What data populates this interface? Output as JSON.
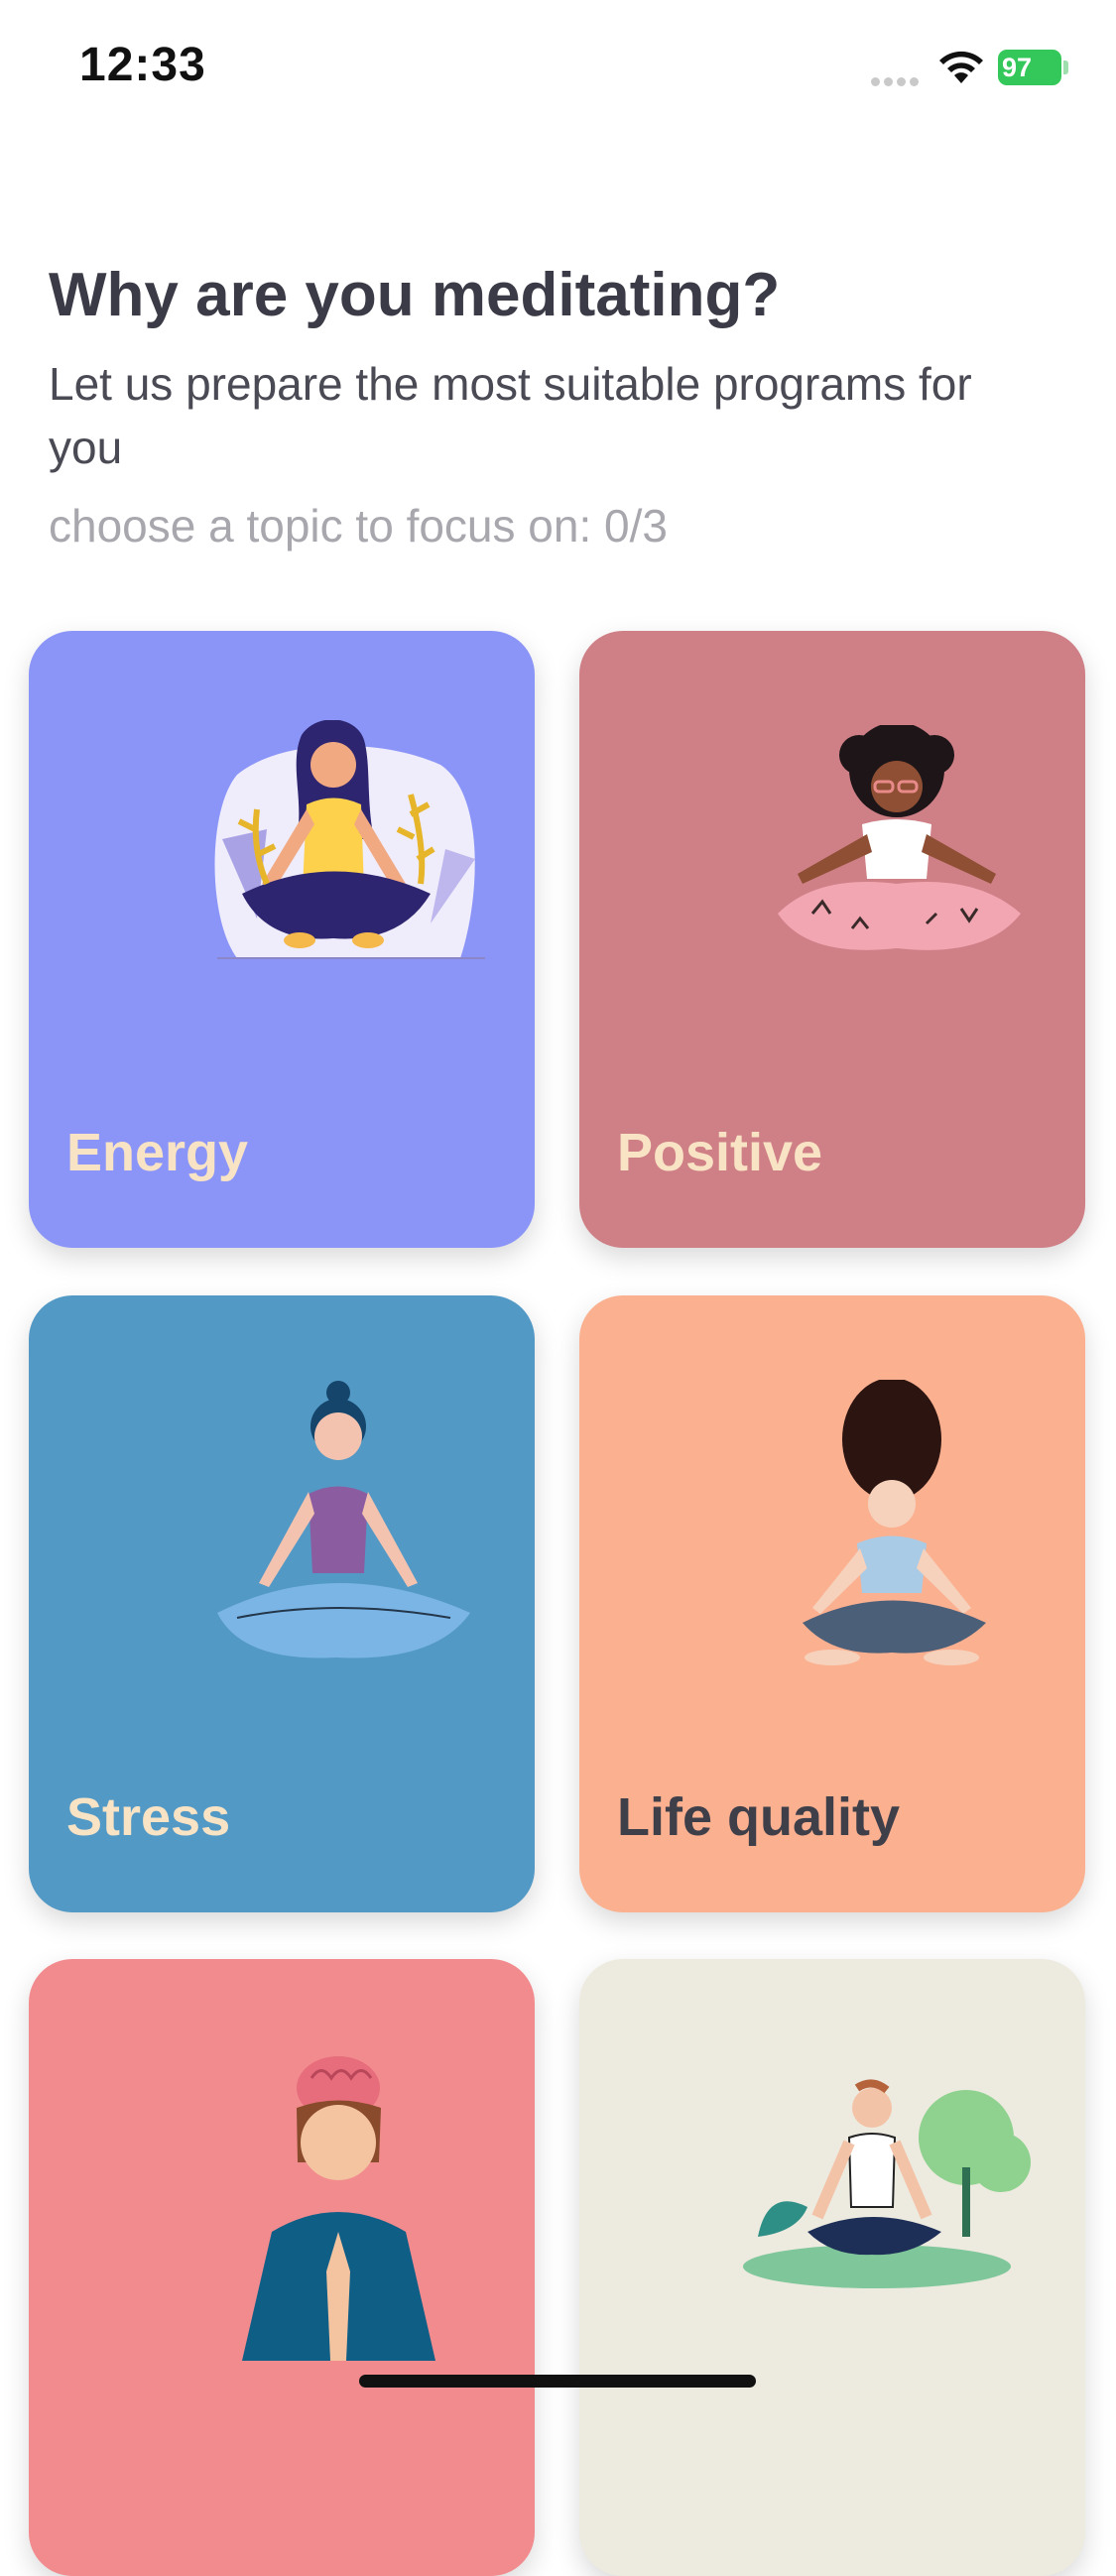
{
  "status_bar": {
    "time": "12:33",
    "battery": "97"
  },
  "header": {
    "title": "Why are you meditating?",
    "subtitle": "Let us prepare the most suitable programs for you",
    "counter": "choose a topic to focus on: 0/3"
  },
  "topics": [
    {
      "label": "Energy",
      "bg": "#8b95f8",
      "label_color": "#f9e3c5"
    },
    {
      "label": "Positive",
      "bg": "#cf7f86",
      "label_color": "#f9e3c5"
    },
    {
      "label": "Stress",
      "bg": "#5399c6",
      "label_color": "#f9e3c5"
    },
    {
      "label": "Life quality",
      "bg": "#fbb090",
      "label_color": "#3f3f4a"
    },
    {
      "label": "",
      "bg": "#f28b8e",
      "label_color": "#f9e3c5"
    },
    {
      "label": "",
      "bg": "#edeadf",
      "label_color": "#3f3f4a"
    }
  ]
}
